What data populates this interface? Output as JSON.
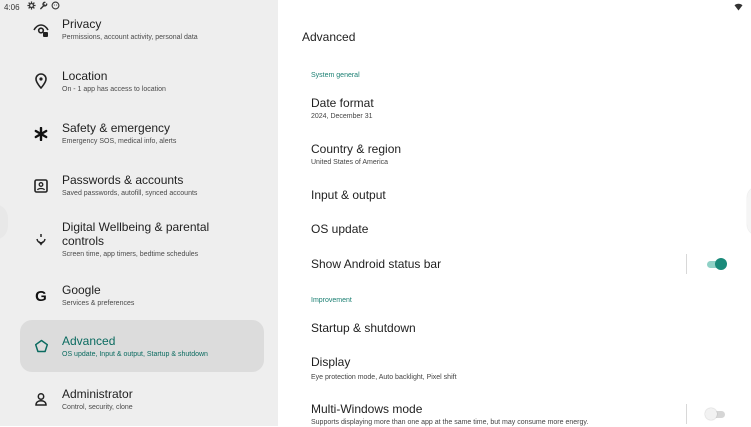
{
  "status_bar": {
    "time": "4:06",
    "icons": [
      "settings-icon",
      "wrench-icon",
      "android-icon"
    ],
    "right_icons": [
      "wifi-icon"
    ]
  },
  "sidebar": {
    "items": [
      {
        "title": "Privacy",
        "subtitle": "Permissions, account activity, personal data",
        "icon": "privacy-eye-icon"
      },
      {
        "title": "Location",
        "subtitle": "On - 1 app has access to location",
        "icon": "location-pin-icon"
      },
      {
        "title": "Safety & emergency",
        "subtitle": "Emergency SOS, medical info, alerts",
        "icon": "emergency-asterisk-icon"
      },
      {
        "title": "Passwords & accounts",
        "subtitle": "Saved passwords, autofill, synced accounts",
        "icon": "account-box-icon"
      },
      {
        "title": "Digital Wellbeing & parental controls",
        "subtitle": "Screen time, app timers, bedtime schedules",
        "icon": "wellbeing-icon"
      },
      {
        "title": "Google",
        "subtitle": "Services & preferences",
        "icon": "google-icon"
      },
      {
        "title": "Advanced",
        "subtitle": "OS update, Input & output, Startup & shutdown",
        "icon": "advanced-star-icon",
        "selected": true
      },
      {
        "title": "Administrator",
        "subtitle": "Control, security, clone",
        "icon": "administrator-person-icon"
      }
    ]
  },
  "main": {
    "title": "Advanced",
    "sections": [
      {
        "header": "System general",
        "rows": [
          {
            "title": "Date format",
            "subtitle": "2024, December 31"
          },
          {
            "title": "Country & region",
            "subtitle": "United States of America"
          },
          {
            "title": "Input & output",
            "subtitle": ""
          },
          {
            "title": "OS update",
            "subtitle": ""
          },
          {
            "title": "Show Android status bar",
            "subtitle": "",
            "toggle": true
          }
        ]
      },
      {
        "header": "Improvement",
        "rows": [
          {
            "title": "Startup & shutdown",
            "subtitle": ""
          },
          {
            "title": "Display",
            "subtitle": "Eye protection mode, Auto backlight, Pixel shift"
          },
          {
            "title": "Multi-Windows mode",
            "subtitle": "Supports displaying more than one app at the same time, but may consume more energy.",
            "toggle": false
          }
        ]
      }
    ]
  },
  "colors": {
    "accent": "#1a8a7a",
    "selected_bg": "#dcdcdc",
    "sidebar_bg": "#eeeeee"
  }
}
